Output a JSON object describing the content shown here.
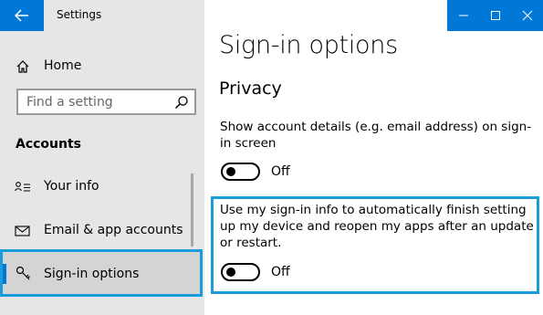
{
  "window": {
    "app_title": "Settings"
  },
  "sidebar": {
    "home_label": "Home",
    "search_placeholder": "Find a setting",
    "section_title": "Accounts",
    "items": [
      {
        "label": "Your info",
        "icon": "person-card-icon"
      },
      {
        "label": "Email & app accounts",
        "icon": "mail-icon"
      },
      {
        "label": "Sign-in options",
        "icon": "key-icon",
        "selected": true
      }
    ]
  },
  "main": {
    "title": "Sign-in options",
    "section": "Privacy",
    "settings": [
      {
        "text": "Show account details (e.g. email address) on sign-in screen",
        "state": "Off"
      },
      {
        "text": "Use my sign-in info to automatically finish setting up my device and reopen my apps after an update or restart.",
        "state": "Off"
      }
    ]
  },
  "colors": {
    "accent": "#0078d7",
    "highlight": "#1a9cdb",
    "sidebar_bg": "#e6e6e6"
  }
}
